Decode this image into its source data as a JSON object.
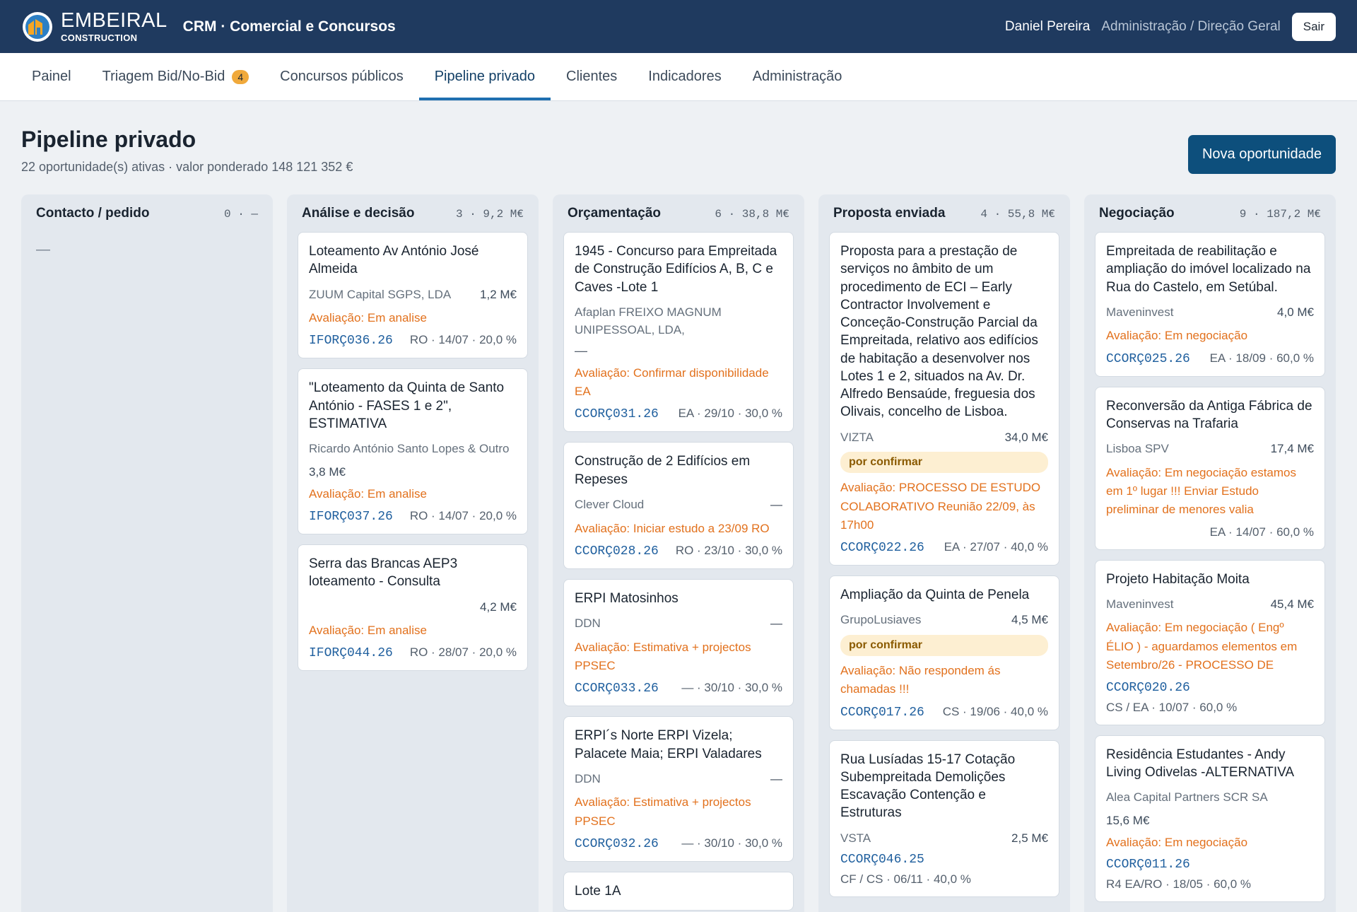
{
  "header": {
    "logo_name": "EMBEIRAL",
    "logo_sub": "CONSTRUCTION",
    "app_title": "CRM · Comercial e Concursos",
    "user_name": "Daniel Pereira",
    "user_role": "Administração / Direção Geral",
    "logout_label": "Sair"
  },
  "tabs": [
    {
      "label": "Painel"
    },
    {
      "label": "Triagem Bid/No-Bid",
      "badge": "4"
    },
    {
      "label": "Concursos públicos"
    },
    {
      "label": "Pipeline privado",
      "active": true
    },
    {
      "label": "Clientes"
    },
    {
      "label": "Indicadores"
    },
    {
      "label": "Administração"
    }
  ],
  "page": {
    "title": "Pipeline privado",
    "subtitle": "22 oportunidade(s) ativas · valor ponderado 148 121 352 €",
    "new_button": "Nova oportunidade"
  },
  "colors": {
    "topbar": "#1f3a5f",
    "accent": "#1f6fb0",
    "primary_button": "#0d4f7c",
    "evaluation": "#e2711d",
    "badge": "#f0a93b"
  },
  "columns": [
    {
      "title": "Contacto / pedido",
      "stats": "0 · —",
      "empty": "—",
      "cards": []
    },
    {
      "title": "Análise e decisão",
      "stats": "3 · 9,2 M€",
      "cards": [
        {
          "title": "Loteamento Av António José Almeida",
          "client": "ZUUM Capital SGPS, LDA",
          "value": "1,2 M€",
          "eval": "Avaliação: Em analise",
          "code": "IFORÇ036.26",
          "meta": "RO · 14/07 · 20,0 %"
        },
        {
          "title": "\"Loteamento da Quinta de Santo António - FASES 1 e 2\", ESTIMATIVA",
          "client": "Ricardo António Santo Lopes & Outro",
          "value_left": "3,8 M€",
          "eval": "Avaliação: Em analise",
          "code": "IFORÇ037.26",
          "meta": "RO · 14/07 · 20,0 %"
        },
        {
          "title": "Serra das Brancas AEP3 loteamento - Consulta",
          "client": "",
          "value": "4,2 M€",
          "eval": "Avaliação: Em analise",
          "code": "IFORÇ044.26",
          "meta": "RO · 28/07 · 20,0 %"
        }
      ]
    },
    {
      "title": "Orçamentação",
      "stats": "6 · 38,8 M€",
      "cards": [
        {
          "title": "1945 - Concurso para Empreitada de Construção Edifícios A, B, C e Caves -Lote 1",
          "client": "Afaplan FREIXO MAGNUM UNIPESSOAL, LDA,",
          "dash_line": "—",
          "eval": "Avaliação: Confirmar disponibilidade EA",
          "code": "CCORÇ031.26",
          "meta": "EA · 29/10 · 30,0 %"
        },
        {
          "title": "Construção de 2 Edifícios em Repeses",
          "client": "Clever Cloud",
          "value": "—",
          "eval": "Avaliação: Iniciar estudo a 23/09 RO",
          "code": "CCORÇ028.26",
          "meta": "RO · 23/10 · 30,0 %"
        },
        {
          "title": "ERPI Matosinhos",
          "client": "DDN",
          "value": "—",
          "eval": "Avaliação: Estimativa + projectos PPSEC",
          "code": "CCORÇ033.26",
          "meta": "— · 30/10 · 30,0 %"
        },
        {
          "title": "ERPI´s Norte ERPI Vizela; Palacete Maia; ERPI Valadares",
          "client": "DDN",
          "value": "—",
          "eval": "Avaliação: Estimativa + projectos PPSEC",
          "code": "CCORÇ032.26",
          "meta": "— · 30/10 · 30,0 %"
        },
        {
          "title": "Lote 1A",
          "client": "",
          "eval": "",
          "code": "",
          "meta": ""
        }
      ]
    },
    {
      "title": "Proposta enviada",
      "stats": "4 · 55,8 M€",
      "cards": [
        {
          "title": "Proposta para a prestação de serviços no âmbito de um procedimento de ECI – Early Contractor Involvement e Conceção-Construção Parcial da Empreitada, relativo aos edifícios de habitação a desenvolver nos Lotes 1 e 2, situados na Av. Dr. Alfredo Bensaúde, freguesia dos Olivais, concelho de Lisboa.",
          "client": "VIZTA",
          "value": "34,0 M€",
          "badge": "por confirmar",
          "eval": "Avaliação: PROCESSO DE ESTUDO COLABORATIVO Reunião 22/09, às 17h00",
          "code": "CCORÇ022.26",
          "meta": "EA · 27/07 · 40,0 %"
        },
        {
          "title": "Ampliação da Quinta de Penela",
          "client": "GrupoLusiaves",
          "value": "4,5 M€",
          "badge": "por confirmar",
          "eval": "Avaliação: Não respondem ás chamadas !!!",
          "code": "CCORÇ017.26",
          "meta": "CS · 19/06 · 40,0 %"
        },
        {
          "title": "Rua Lusíadas 15-17 Cotação Subempreitada Demolições Escavação Contenção e Estruturas",
          "client": "VSTA",
          "value": "2,5 M€",
          "eval": "",
          "code": "CCORÇ046.25",
          "meta_below": "CF / CS · 06/11 · 40,0 %"
        }
      ]
    },
    {
      "title": "Negociação",
      "stats": "9 · 187,2 M€",
      "cards": [
        {
          "title": "Empreitada de reabilitação e ampliação do imóvel localizado na Rua do Castelo, em Setúbal.",
          "client": "Maveninvest",
          "value": "4,0 M€",
          "eval": "Avaliação: Em negociação",
          "code": "CCORÇ025.26",
          "meta": "EA · 18/09 · 60,0 %"
        },
        {
          "title": "Reconversão da Antiga Fábrica de Conservas na Trafaria",
          "client": "Lisboa SPV",
          "value": "17,4 M€",
          "eval": "Avaliação: Em negociação estamos em 1º lugar !!! Enviar Estudo preliminar de menores valia",
          "code": "",
          "meta": "EA · 14/07 · 60,0 %"
        },
        {
          "title": "Projeto Habitação Moita",
          "client": "Maveninvest",
          "value": "45,4 M€",
          "eval": "Avaliação: Em negociação ( Engº ÉLIO ) - aguardamos elementos em Setembro/26 - PROCESSO DE",
          "code": "CCORÇ020.26",
          "meta_below": "CS / EA · 10/07 · 60,0 %"
        },
        {
          "title": "Residência Estudantes - Andy Living Odivelas -ALTERNATIVA",
          "client": "Alea Capital Partners SCR SA",
          "value_left": "15,6 M€",
          "eval": "Avaliação: Em negociação",
          "code": "CCORÇ011.26",
          "meta_below": "R4 EA/RO · 18/05 · 60,0 %"
        }
      ]
    }
  ]
}
